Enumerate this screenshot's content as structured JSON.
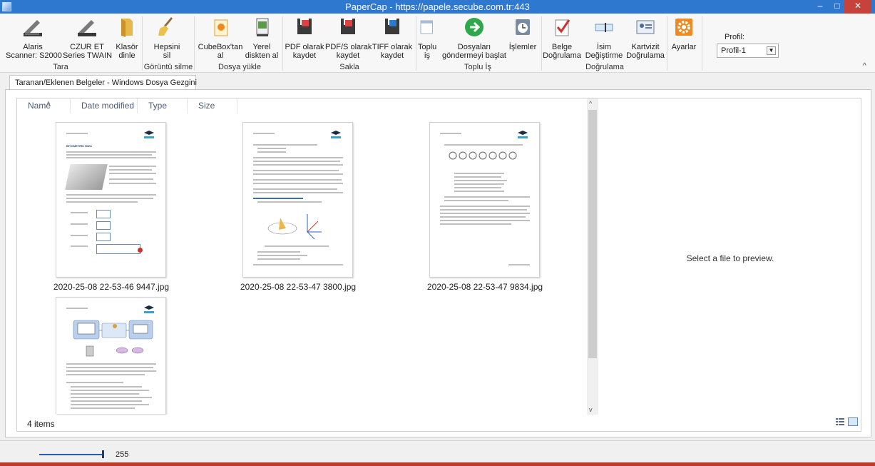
{
  "window": {
    "title": "PaperCap - https://papele.secube.com.tr:443",
    "min_glyph": "–",
    "max_glyph": "□",
    "close_glyph": "✕"
  },
  "ribbon": {
    "buttons": [
      {
        "label": "Alaris\nScanner: S2000",
        "icon": "scanner-icon"
      },
      {
        "label": "CZUR ET\nSeries TWAIN",
        "icon": "scanner-icon"
      },
      {
        "label": "Klasör\ndinle",
        "icon": "folder-icon"
      },
      {
        "label": "Hepsini\nsil",
        "icon": "broom-icon"
      },
      {
        "label": "CubeBox'tan\nal",
        "icon": "cubebox-icon"
      },
      {
        "label": "Yerel\ndiskten al",
        "icon": "local-disk-icon"
      },
      {
        "label": "PDF olarak\nkaydet",
        "icon": "pdf-save-icon"
      },
      {
        "label": "PDF/S olarak\nkaydet",
        "icon": "pdfs-save-icon"
      },
      {
        "label": "TIFF olarak\nkaydet",
        "icon": "tiff-save-icon"
      },
      {
        "label": "Toplu\niş",
        "icon": "batch-icon"
      },
      {
        "label": "Dosyaları\ngöndermeyi başlat",
        "icon": "start-send-icon"
      },
      {
        "label": "İşlemler",
        "icon": "clock-icon"
      },
      {
        "label": "Belge\nDoğrulama",
        "icon": "document-verify-icon"
      },
      {
        "label": "İsim\nDeğiştirme",
        "icon": "rename-icon"
      },
      {
        "label": "Kartvizit\nDoğrulama",
        "icon": "business-card-icon"
      },
      {
        "label": "Ayarlar",
        "icon": "gear-icon"
      }
    ],
    "groups": [
      "Tara",
      "Görüntü silme",
      "Dosya yükle",
      "Sakla",
      "Toplu İş",
      "Doğrulama"
    ],
    "profile_label": "Profil:",
    "profile_value": "Profil-1",
    "collapse_glyph": "^"
  },
  "tab": {
    "label": "Taranan/Eklenen Belgeler - Windows Dosya Gezgini"
  },
  "explorer": {
    "columns": [
      "Name",
      "Date modified",
      "Type",
      "Size"
    ],
    "files": [
      {
        "name": "2020-25-08 22-53-46 9447.jpg",
        "doc_title": "BİYOMETRİK İMZA"
      },
      {
        "name": "2020-25-08 22-53-47 3800.jpg",
        "doc_title": ""
      },
      {
        "name": "2020-25-08 22-53-47 9834.jpg",
        "doc_title": ""
      },
      {
        "name": "",
        "doc_title": ""
      }
    ],
    "preview_text": "Select a file to preview.",
    "status": "4 items",
    "scroll_up": "^",
    "scroll_down": "v"
  },
  "zoom": {
    "value": "255"
  },
  "colors": {
    "titlebar": "#2f78d0",
    "close": "#c7423a",
    "accent": "#2a5ea8"
  }
}
